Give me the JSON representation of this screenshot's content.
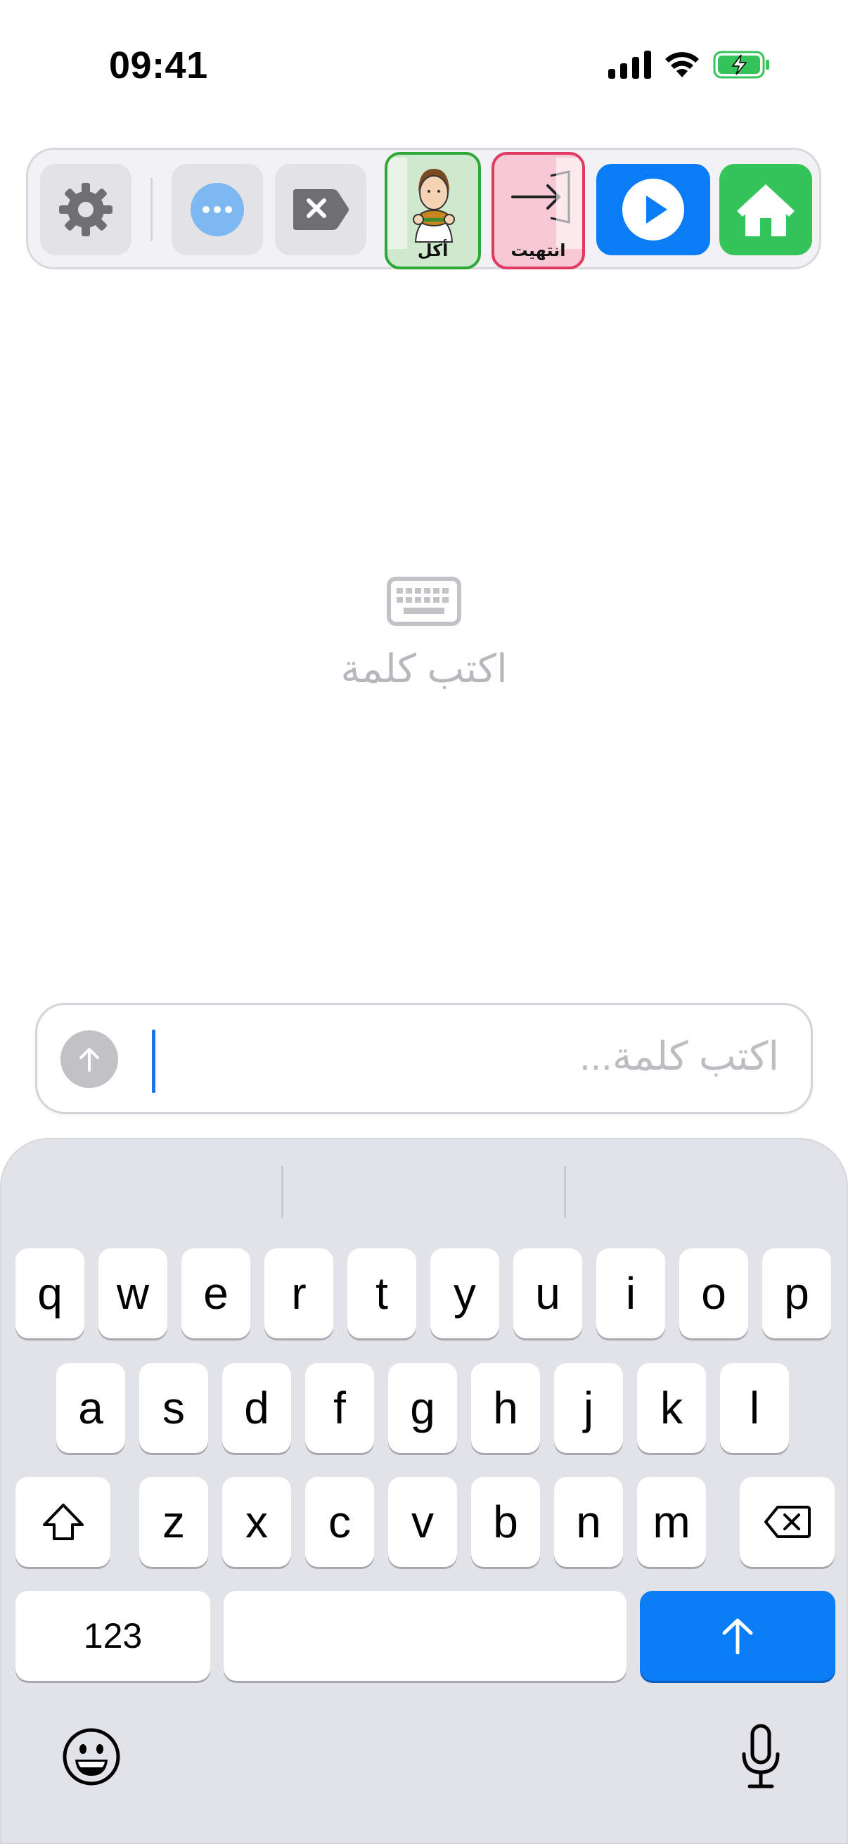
{
  "status_bar": {
    "time": "09:41",
    "icons": [
      "cellular-signal-icon",
      "wifi-icon",
      "battery-charging-icon"
    ],
    "battery_color": "#34c45a"
  },
  "toolbar": {
    "buttons": [
      "gear-icon",
      "more-icon",
      "delete-tag-icon",
      "play-icon",
      "home-icon"
    ],
    "cards": [
      {
        "label": "أكل",
        "color": "#2da836"
      },
      {
        "label": "انتهيت",
        "color": "#e03a62"
      }
    ],
    "accent_blue": "#0a7cf5",
    "accent_green": "#34c45a"
  },
  "empty_state": {
    "icon": "keyboard-icon",
    "text": "اكتب كلمة"
  },
  "input": {
    "placeholder": "اكتب كلمة...",
    "value": ""
  },
  "keyboard": {
    "row1": [
      "q",
      "w",
      "e",
      "r",
      "t",
      "y",
      "u",
      "i",
      "o",
      "p"
    ],
    "row2": [
      "a",
      "s",
      "d",
      "f",
      "g",
      "h",
      "j",
      "k",
      "l"
    ],
    "row3": [
      "z",
      "x",
      "c",
      "v",
      "b",
      "n",
      "m"
    ],
    "numbers_label": "123",
    "return_color": "#0a7cf5"
  }
}
